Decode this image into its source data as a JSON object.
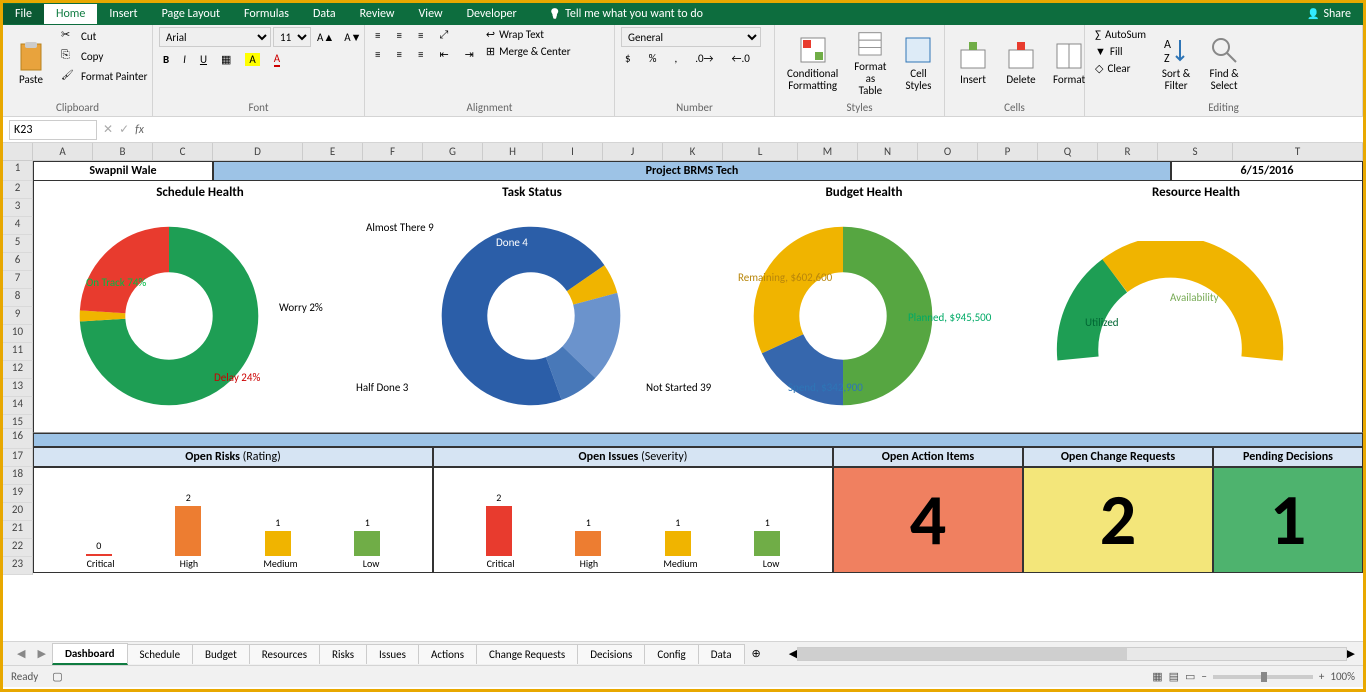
{
  "ribbon": {
    "tabs": [
      "File",
      "Home",
      "Insert",
      "Page Layout",
      "Formulas",
      "Data",
      "Review",
      "View",
      "Developer"
    ],
    "active_tab": "Home",
    "tell_me": "Tell me what you want to do",
    "share": "Share",
    "clipboard": {
      "paste": "Paste",
      "cut": "Cut",
      "copy": "Copy",
      "painter": "Format Painter",
      "label": "Clipboard"
    },
    "font": {
      "name": "Arial",
      "size": "11",
      "label": "Font"
    },
    "alignment": {
      "wrap": "Wrap Text",
      "merge": "Merge & Center",
      "label": "Alignment"
    },
    "number": {
      "format": "General",
      "label": "Number"
    },
    "styles": {
      "cond": "Conditional\nFormatting",
      "table": "Format as\nTable",
      "cell": "Cell\nStyles",
      "label": "Styles"
    },
    "cells": {
      "insert": "Insert",
      "delete": "Delete",
      "format": "Format",
      "label": "Cells"
    },
    "editing": {
      "autosum": "AutoSum",
      "fill": "Fill",
      "clear": "Clear",
      "sort": "Sort &\nFilter",
      "find": "Find &\nSelect",
      "label": "Editing"
    }
  },
  "formula_bar": {
    "name_box": "K23",
    "fx": "fx",
    "value": ""
  },
  "columns": [
    "A",
    "B",
    "C",
    "D",
    "E",
    "F",
    "G",
    "H",
    "I",
    "J",
    "K",
    "L",
    "M",
    "N",
    "O",
    "P",
    "Q",
    "R",
    "S",
    "T"
  ],
  "rows": [
    1,
    2,
    3,
    4,
    5,
    6,
    7,
    8,
    9,
    10,
    11,
    12,
    13,
    14,
    15,
    16,
    17,
    18,
    19,
    20,
    21,
    22,
    23
  ],
  "dashboard": {
    "author": "Swapnil Wale",
    "project": "Project BRMS Tech",
    "date": "6/15/2016",
    "schedule": {
      "title": "Schedule Health"
    },
    "task": {
      "title": "Task Status"
    },
    "budget": {
      "title": "Budget Health"
    },
    "resource": {
      "title": "Resource Health"
    },
    "risks": {
      "title": "Open Risks",
      "sub": "(Rating)"
    },
    "issues": {
      "title": "Open Issues",
      "sub": "(Severity)"
    },
    "action": {
      "title": "Open Action Items",
      "value": "4"
    },
    "change": {
      "title": "Open Change Requests",
      "value": "2"
    },
    "pending": {
      "title": "Pending Decisions",
      "value": "1"
    }
  },
  "chart_data": [
    {
      "type": "pie",
      "title": "Schedule Health",
      "series": [
        {
          "name": "On Track",
          "value": 74,
          "label": "On Track 74%",
          "color": "#1e9e54"
        },
        {
          "name": "Worry",
          "value": 2,
          "label": "Worry 2%",
          "color": "#f0b400"
        },
        {
          "name": "Delay",
          "value": 24,
          "label": "Delay 24%",
          "color": "#e83b2e"
        }
      ]
    },
    {
      "type": "pie",
      "title": "Task Status",
      "series": [
        {
          "name": "Not Started",
          "value": 39,
          "label": "Not Started 39",
          "color": "#2b5ea8"
        },
        {
          "name": "Half Done",
          "value": 3,
          "label": "Half Done 3",
          "color": "#f0b400"
        },
        {
          "name": "Almost There",
          "value": 9,
          "label": "Almost There 9",
          "color": "#6b93cc"
        },
        {
          "name": "Done",
          "value": 4,
          "label": "Done 4",
          "color": "#4878b8"
        }
      ]
    },
    {
      "type": "pie",
      "title": "Budget Health",
      "series": [
        {
          "name": "Planned",
          "value": 945500,
          "label": "Planned, $945,500",
          "color": "#56a641"
        },
        {
          "name": "Spend",
          "value": 342900,
          "label": "Spend, $342,900",
          "color": "#3667ad"
        },
        {
          "name": "Remaining",
          "value": 602600,
          "label": "Remaining, $602,600",
          "color": "#f0b400"
        }
      ]
    },
    {
      "type": "pie",
      "title": "Resource Health",
      "series": [
        {
          "name": "Utilized",
          "value": 20,
          "label": "Utilized",
          "color": "#1e9e54"
        },
        {
          "name": "Availability",
          "value": 80,
          "label": "Availability",
          "color": "#f0b400"
        }
      ],
      "half": true
    },
    {
      "type": "bar",
      "title": "Open Risks (Rating)",
      "categories": [
        "Critical",
        "High",
        "Medium",
        "Low"
      ],
      "values": [
        0,
        2,
        1,
        1
      ],
      "colors": [
        "#e83b2e",
        "#ed7d31",
        "#f0b400",
        "#70ad47"
      ]
    },
    {
      "type": "bar",
      "title": "Open Issues (Severity)",
      "categories": [
        "Critical",
        "High",
        "Medium",
        "Low"
      ],
      "values": [
        2,
        1,
        1,
        1
      ],
      "colors": [
        "#e83b2e",
        "#ed7d31",
        "#f0b400",
        "#70ad47"
      ]
    }
  ],
  "labels": {
    "schedule": {
      "ontrack": "On Track 74%",
      "worry": "Worry 2%",
      "delay": "Delay 24%"
    },
    "task": {
      "done": "Done 4",
      "almost": "Almost There 9",
      "half": "Half Done 3",
      "notstarted": "Not Started 39"
    },
    "budget": {
      "planned": "Planned, $945,500",
      "spend": "Spend, $342,900",
      "remaining": "Remaining, $602,600"
    },
    "resource": {
      "util": "Utilized",
      "avail": "Availability"
    },
    "bar_cats": [
      "Critical",
      "High",
      "Medium",
      "Low"
    ],
    "risk_vals": [
      "0",
      "2",
      "1",
      "1"
    ],
    "issue_vals": [
      "2",
      "1",
      "1",
      "1"
    ]
  },
  "sheet_tabs": [
    "Dashboard",
    "Schedule",
    "Budget",
    "Resources",
    "Risks",
    "Issues",
    "Actions",
    "Change Requests",
    "Decisions",
    "Config",
    "Data"
  ],
  "active_sheet": "Dashboard",
  "status": {
    "ready": "Ready",
    "zoom": "100%"
  }
}
